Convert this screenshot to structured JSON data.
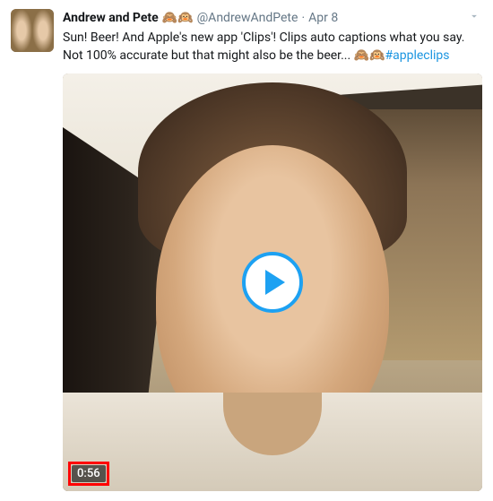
{
  "tweet": {
    "author": {
      "display_name": "Andrew and Pete",
      "name_emoji": "🙈🙉",
      "username": "@AndrewAndPete",
      "separator": "·",
      "date": "Apr 8"
    },
    "text": {
      "part1": "Sun! Beer! And Apple's new app 'Clips'! Clips auto captions what you say. Not 100% accurate but that might also be the beer... ",
      "emoji": "🙈🙉",
      "hashtag": "#appleclips"
    },
    "video": {
      "duration": "0:56"
    }
  }
}
